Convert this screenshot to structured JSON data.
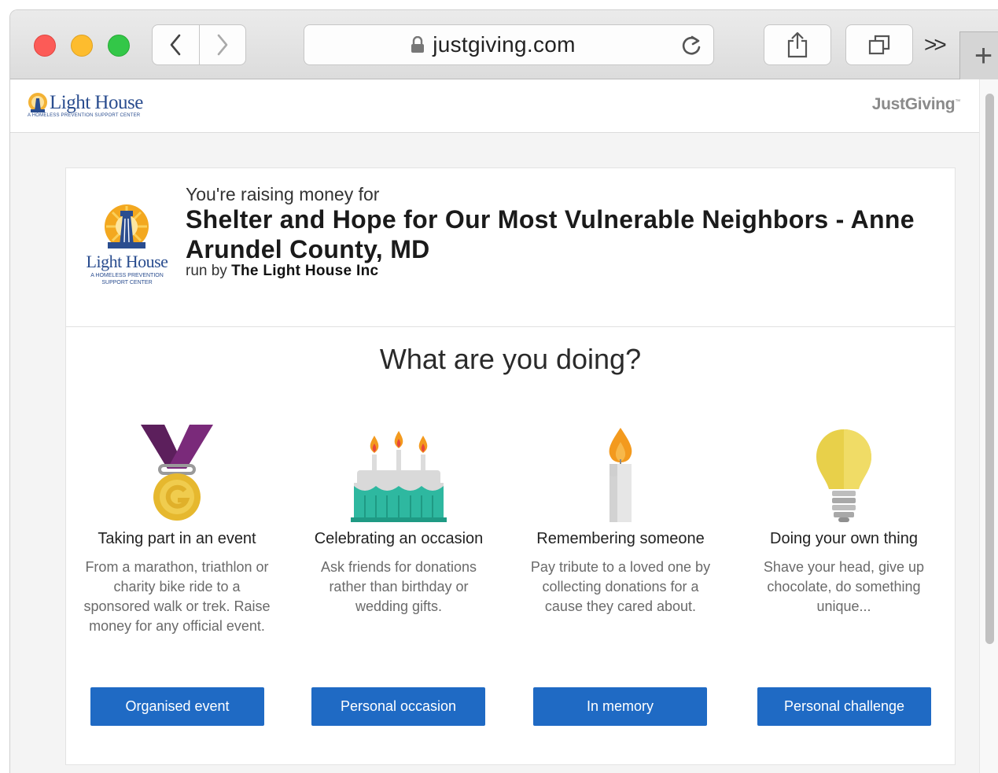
{
  "browser": {
    "url": "justgiving.com",
    "overflow_label": ">>",
    "new_tab_label": "+"
  },
  "site_header": {
    "charity_logo_name": "Light House",
    "charity_logo_tagline": "A HOMELESS PREVENTION SUPPORT CENTER",
    "platform_logo": "JustGiving",
    "platform_logo_tm": "™"
  },
  "cause": {
    "intro": "You're raising money for",
    "title": "Shelter and Hope for Our Most Vulnerable Neighbors - Anne Arundel County, MD",
    "run_by_prefix": "run by",
    "run_by_org": "The Light House Inc",
    "logo_name": "Light House",
    "logo_tagline": "A HOMELESS PREVENTION SUPPORT CENTER"
  },
  "question": "What are you doing?",
  "options": [
    {
      "icon": "medal-icon",
      "title": "Taking part in an event",
      "description": "From a marathon, triathlon or charity bike ride to a sponsored walk or trek. Raise money for any official event.",
      "button": "Organised event"
    },
    {
      "icon": "birthday-cake-icon",
      "title": "Celebrating an occasion",
      "description": "Ask friends for donations rather than birthday or wedding gifts.",
      "button": "Personal occasion"
    },
    {
      "icon": "candle-icon",
      "title": "Remembering someone",
      "description": "Pay tribute to a loved one by collecting donations for a cause they cared about.",
      "button": "In memory"
    },
    {
      "icon": "lightbulb-icon",
      "title": "Doing your own thing",
      "description": "Shave your head, give up chocolate, do something unique...",
      "button": "Personal challenge"
    }
  ],
  "colors": {
    "button_blue": "#1f6ac4",
    "logo_blue": "#2a4d8f"
  }
}
